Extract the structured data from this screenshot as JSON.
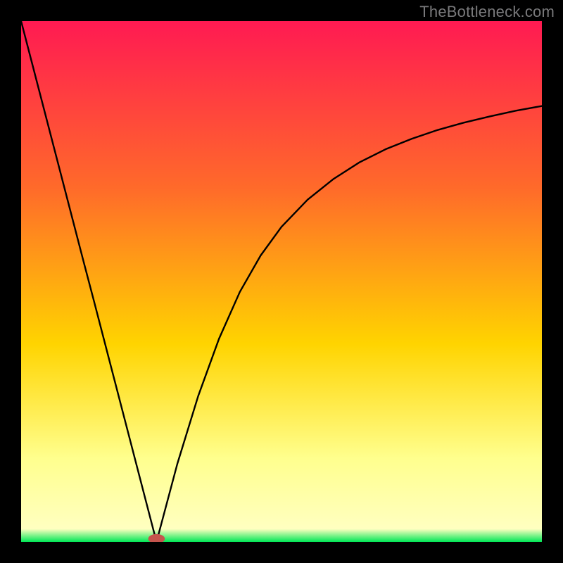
{
  "watermark": "TheBottleneck.com",
  "colors": {
    "frame": "#000000",
    "gradient_top": "#ff1a52",
    "gradient_mid1": "#ff6a2a",
    "gradient_mid2": "#ffd400",
    "gradient_soft": "#ffff8e",
    "gradient_bottom": "#00e756",
    "curve": "#000000",
    "marker": "#c5544d"
  },
  "chart_data": {
    "type": "line",
    "title": "",
    "xlabel": "",
    "ylabel": "",
    "xlim": [
      0,
      100
    ],
    "ylim": [
      0,
      100
    ],
    "minimum_x": 26,
    "marker": {
      "x": 26,
      "y": 0.6,
      "rx": 1.6,
      "ry": 0.9
    },
    "left_branch": {
      "x": [
        0,
        2,
        4,
        6,
        8,
        10,
        12,
        14,
        16,
        18,
        20,
        22,
        24,
        26
      ],
      "y": [
        100,
        92.3,
        84.6,
        76.9,
        69.2,
        61.5,
        53.8,
        46.2,
        38.5,
        30.8,
        23.1,
        15.4,
        7.7,
        0
      ]
    },
    "right_branch": {
      "x": [
        26,
        30,
        34,
        38,
        42,
        46,
        50,
        55,
        60,
        65,
        70,
        75,
        80,
        85,
        90,
        95,
        100
      ],
      "y": [
        0,
        15,
        28,
        39,
        48,
        55,
        60.5,
        65.7,
        69.7,
        72.9,
        75.4,
        77.4,
        79.1,
        80.5,
        81.7,
        82.8,
        83.7
      ]
    }
  }
}
